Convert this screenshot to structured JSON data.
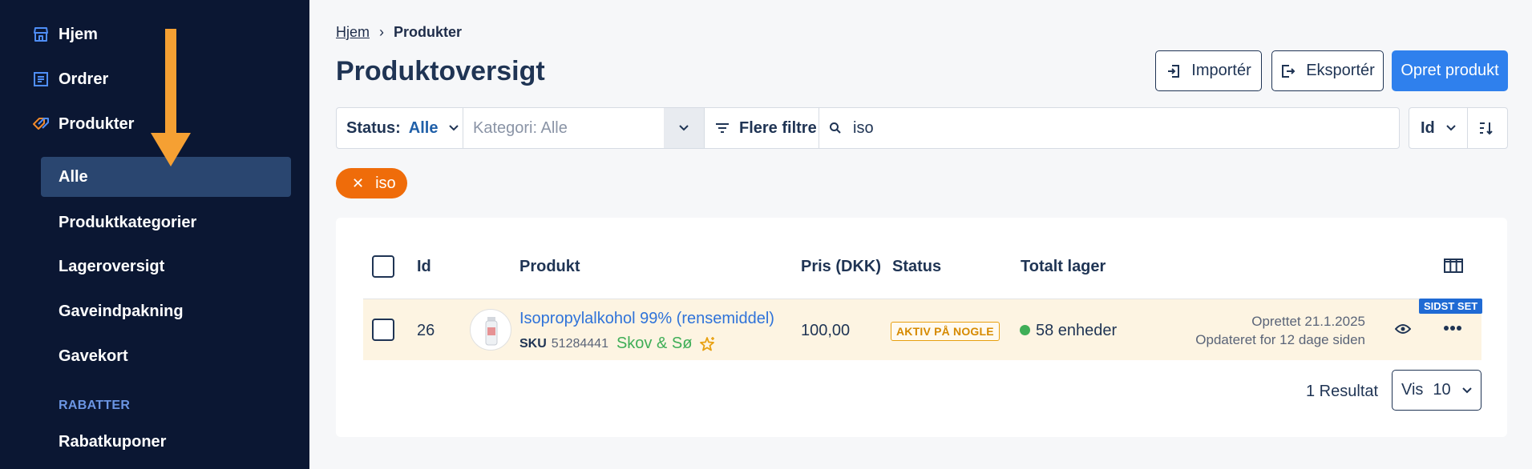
{
  "sidebar": {
    "nav": [
      {
        "label": "Hjem",
        "icon": "store-icon"
      },
      {
        "label": "Ordrer",
        "icon": "receipt-icon"
      },
      {
        "label": "Produkter",
        "icon": "tag-icon"
      }
    ],
    "sub_items": [
      {
        "label": "Alle",
        "active": true
      },
      {
        "label": "Produktkategorier"
      },
      {
        "label": "Lageroversigt"
      },
      {
        "label": "Gaveindpakning"
      },
      {
        "label": "Gavekort"
      }
    ],
    "section": "RABATTER",
    "section_items": [
      {
        "label": "Rabatkuponer"
      }
    ],
    "accent_color": "#f5a033"
  },
  "breadcrumb": {
    "home": "Hjem",
    "separator": "›",
    "current": "Produkter"
  },
  "page_title": "Produktoversigt",
  "actions": {
    "import": "Importér",
    "export": "Eksportér",
    "create": "Opret produkt"
  },
  "filters": {
    "status_label": "Status:",
    "status_value": "Alle",
    "category_placeholder": "Kategori: Alle",
    "more_filters": "Flere filtre",
    "search_value": "iso",
    "sort_field": "Id"
  },
  "active_chip": "iso",
  "table": {
    "columns": [
      "Id",
      "Produkt",
      "Pris (DKK)",
      "Status",
      "Totalt lager"
    ],
    "rows": [
      {
        "id": "26",
        "name": "Isopropylalkohol 99% (rensemiddel)",
        "sku_label": "SKU",
        "sku": "51284441",
        "brand": "Skov & Sø",
        "price": "100,00",
        "status": "AKTIV PÅ NOGLE",
        "stock": "58 enheder",
        "created": "Oprettet 21.1.2025",
        "updated": "Opdateret for 12 dage siden",
        "badge": "SIDST SET"
      }
    ]
  },
  "pagination": {
    "result_text": "1 Resultat",
    "per_page_label": "Vis",
    "per_page_value": "10"
  },
  "colors": {
    "primary": "#2f80ed",
    "chip": "#ef6c0a",
    "sidebar": "#0b1733",
    "row_highlight": "#fdf4e2"
  }
}
